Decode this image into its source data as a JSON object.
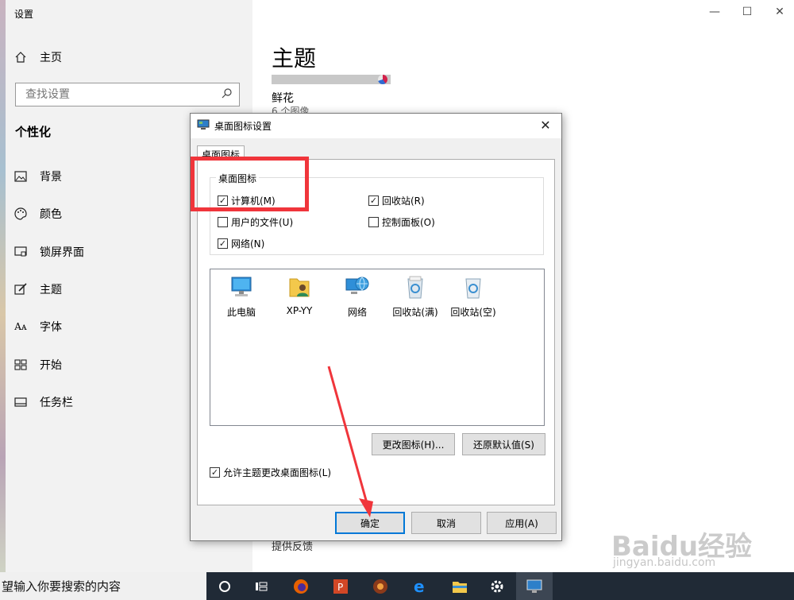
{
  "window": {
    "title": "设置"
  },
  "sidebar": {
    "home_label": "主页",
    "search_placeholder": "查找设置",
    "section_title": "个性化",
    "items": [
      {
        "label": "背景",
        "icon": "image-icon"
      },
      {
        "label": "颜色",
        "icon": "palette-icon"
      },
      {
        "label": "锁屏界面",
        "icon": "lock-screen-icon"
      },
      {
        "label": "主题",
        "icon": "theme-brush-icon"
      },
      {
        "label": "字体",
        "icon": "font-icon"
      },
      {
        "label": "开始",
        "icon": "start-grid-icon"
      },
      {
        "label": "任务栏",
        "icon": "taskbar-icon"
      }
    ]
  },
  "main": {
    "heading": "主题",
    "theme_name": "鲜花",
    "theme_count": "6 个图像",
    "feedback": "提供反馈"
  },
  "dialog": {
    "title": "桌面图标设置",
    "close_glyph": "✕",
    "tab": "桌面图标",
    "group_label": "桌面图标",
    "checkboxes": [
      {
        "label": "计算机(M)",
        "checked": true
      },
      {
        "label": "回收站(R)",
        "checked": true
      },
      {
        "label": "用户的文件(U)",
        "checked": false
      },
      {
        "label": "控制面板(O)",
        "checked": false
      },
      {
        "label": "网络(N)",
        "checked": true
      }
    ],
    "icons": [
      {
        "label": "此电脑",
        "icon": "computer-icon"
      },
      {
        "label": "XP-YY",
        "icon": "user-folder-icon"
      },
      {
        "label": "网络",
        "icon": "network-icon"
      },
      {
        "label": "回收站(满)",
        "icon": "recycle-bin-full-icon"
      },
      {
        "label": "回收站(空)",
        "icon": "recycle-bin-empty-icon"
      }
    ],
    "change_icon_button": "更改图标(H)...",
    "restore_default_button": "还原默认值(S)",
    "allow_theme": {
      "label": "允许主题更改桌面图标(L)",
      "checked": true
    },
    "ok_button": "确定",
    "cancel_button": "取消",
    "apply_button": "应用(A)"
  },
  "taskbar": {
    "search_text": "望输入你要搜索的内容",
    "apps": [
      "cortana-icon",
      "task-view-icon",
      "firefox-icon",
      "powerpoint-icon",
      "game-icon",
      "edge-icon",
      "file-explorer-icon",
      "settings-gear-icon",
      "desktop-icon-settings-icon"
    ]
  },
  "watermark": {
    "logo": "Baidu经验",
    "url": "jingyan.baidu.com"
  },
  "colors": {
    "annotation_red": "#f0353b",
    "focus_blue": "#0078d7",
    "taskbar": "#202a36"
  }
}
